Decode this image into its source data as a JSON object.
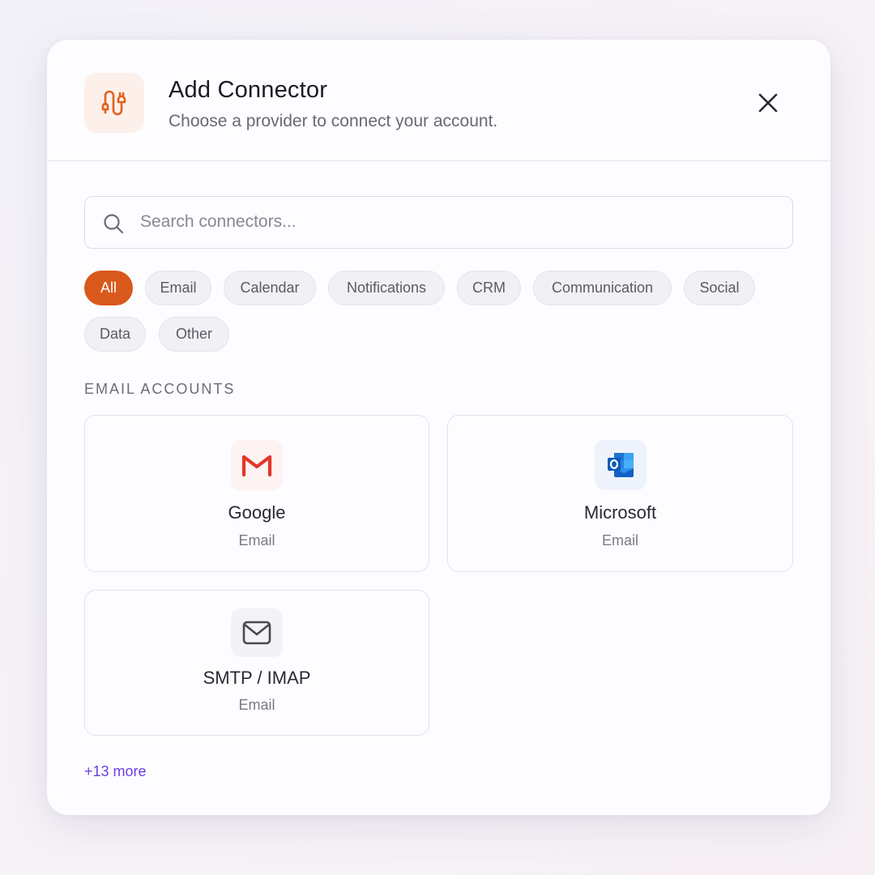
{
  "dialog": {
    "title": "Add Connector",
    "subtitle": "Choose a provider to connect your account.",
    "header_icon": "plug-icon",
    "close_icon": "close-icon"
  },
  "search": {
    "placeholder": "Search connectors...",
    "value": "",
    "icon": "search-icon"
  },
  "filters": {
    "active": "All",
    "items": [
      "All",
      "Email",
      "Calendar",
      "Notifications",
      "CRM",
      "Communication",
      "Social",
      "Data",
      "Other"
    ]
  },
  "section": {
    "label": "EMAIL ACCOUNTS"
  },
  "connectors": [
    {
      "name": "Google",
      "type": "Email",
      "icon": "gmail-icon"
    },
    {
      "name": "Microsoft",
      "type": "Email",
      "icon": "outlook-icon"
    },
    {
      "name": "SMTP / IMAP",
      "type": "Email",
      "icon": "envelope-icon"
    }
  ],
  "more_link": "+13 more",
  "colors": {
    "accent": "#d9581c",
    "link": "#6a3fe0",
    "gmail_red": "#e5352b",
    "outlook_blue": "#1d6fd6"
  }
}
